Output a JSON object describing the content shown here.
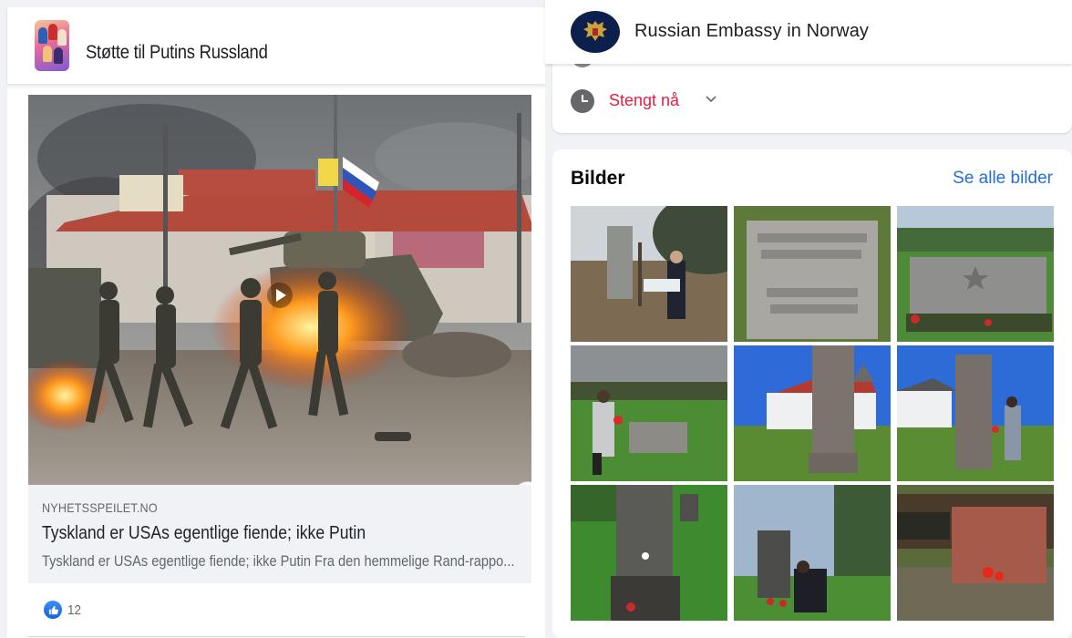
{
  "left": {
    "page_name": "Støtte til Putins Russland",
    "post": {
      "link_domain": "NYHETSSPEILET.NO",
      "link_title": "Tyskland er USAs egentlige fiende; ikke Putin",
      "link_description": "Tyskland er USAs egentlige fiende; ikke Putin Fra den hemmelige Rand-rappo...",
      "info_label": "i",
      "reaction_count": "12",
      "reaction_icon": "like-icon",
      "hero_icon": "play-icon"
    }
  },
  "right": {
    "page_name": "Russian Embassy in Norway",
    "status": "Stengt nå",
    "status_icon": "clock-icon",
    "photos": {
      "title": "Bilder",
      "see_all": "Se alle bilder",
      "count": 9
    }
  },
  "colors": {
    "background": "#f0f2f5",
    "link_blue": "#216fdb",
    "closed_red": "#e41e3f",
    "like_blue": "#1877f2"
  }
}
